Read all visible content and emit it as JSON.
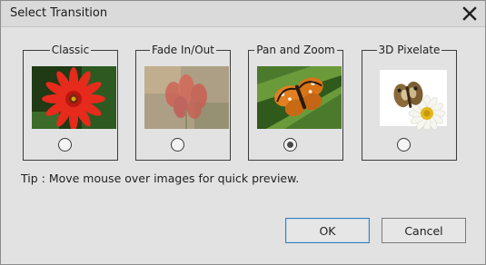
{
  "dialog": {
    "title": "Select Transition",
    "close_icon": "close-icon"
  },
  "transitions": [
    {
      "label": "Classic",
      "thumbnail": "red-gerbera-flower",
      "selected": false
    },
    {
      "label": "Fade In/Out",
      "thumbnail": "faded-red-flower",
      "selected": false
    },
    {
      "label": "Pan and Zoom",
      "thumbnail": "butterfly-on-leaf",
      "selected": true
    },
    {
      "label": "3D Pixelate",
      "thumbnail": "butterfly-on-white-daisy",
      "selected": false
    }
  ],
  "tip": "Tip : Move mouse over images for quick preview.",
  "buttons": {
    "ok": "OK",
    "cancel": "Cancel"
  },
  "colors": {
    "dialog_bg": "#e2e2e2",
    "default_button_border": "#3c7fb1"
  }
}
